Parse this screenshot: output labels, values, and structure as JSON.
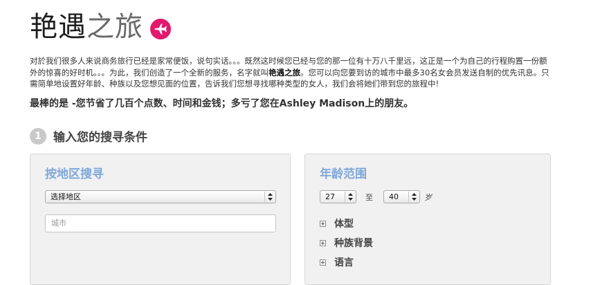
{
  "header": {
    "title_dark": "艳遇",
    "title_light": "之旅",
    "badge_icon": "airplane-icon",
    "badge_color": "#e3196d"
  },
  "intro": {
    "part1": "对於我们很多人来说商务旅行已经是家常便饭，说句实话。。。既然这时候您已经与您的那一位有十万八千里远，这正是一个为自己的行程购置一份额外的惊喜的好时机。。。为此，我们创造了一个全新的服务，名字就叫",
    "brand": "艳遇之旅",
    "part2": "。您可以向您要到访的城市中最多30名女会员发送自制的优先讯息。只需简单地设置好年龄、种族以及您想见面的位置，告诉我们您想寻找哪种类型的女人，我们会将她们带到您的旅程中!"
  },
  "best_line": "最棒的是 -您节省了几百个点数、时间和金钱；多亏了您在Ashley Madison上的朋友。",
  "step": {
    "number": "1",
    "title": "输入您的搜寻条件"
  },
  "location_panel": {
    "title": "按地区搜寻",
    "region_select_value": "选择地区",
    "city_placeholder": "城市"
  },
  "age_panel": {
    "title": "年龄范围",
    "from": "27",
    "separator": "至",
    "to": "40",
    "unit": "岁",
    "filters": [
      "体型",
      "种族背景",
      "语言"
    ]
  },
  "colors": {
    "accent_blue": "#7fa7d9",
    "panel_bg": "#f1f1f1"
  }
}
